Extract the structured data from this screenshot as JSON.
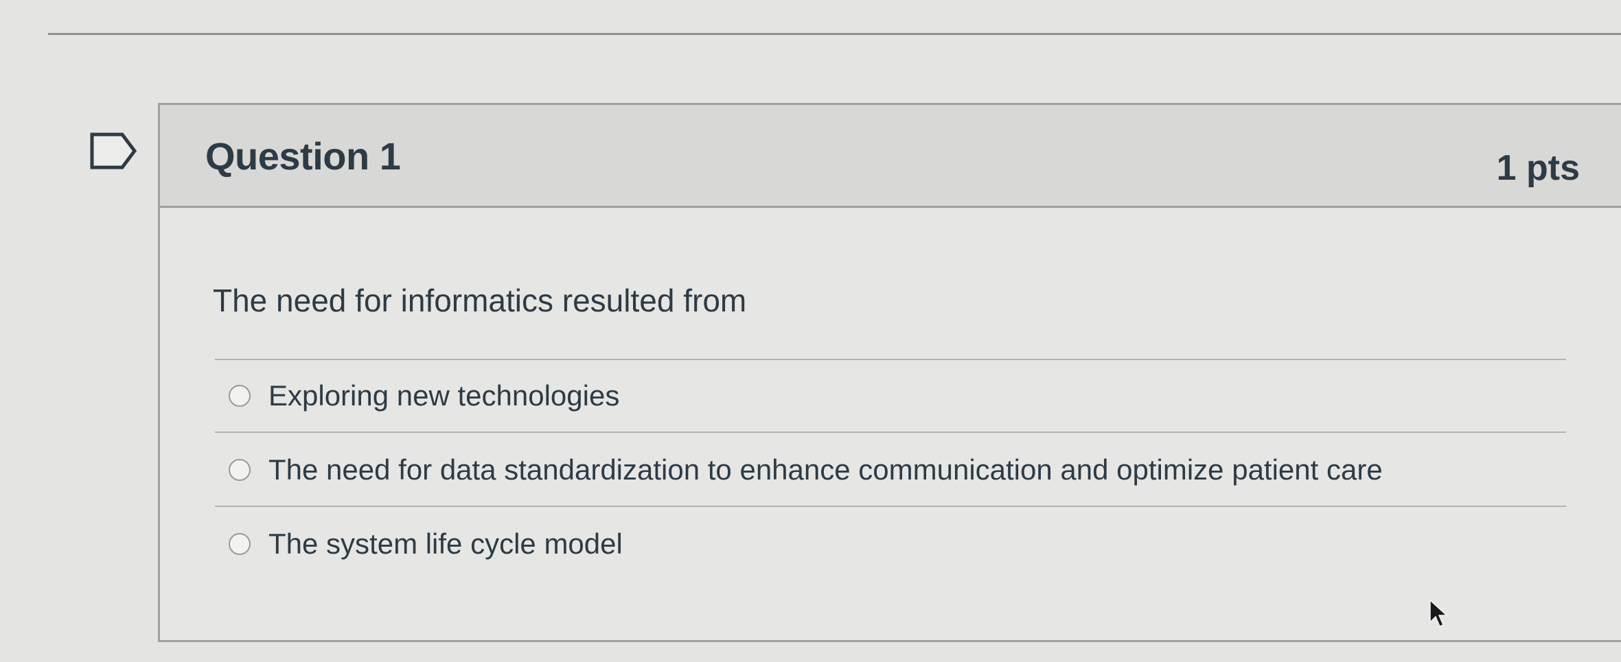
{
  "question": {
    "title": "Question 1",
    "points": "1 pts",
    "prompt": "The need for informatics resulted from",
    "flag_icon": "flag-outline-icon",
    "answers": [
      {
        "label": "Exploring new technologies",
        "selected": false
      },
      {
        "label": "The need for data standardization to enhance communication and optimize patient care",
        "selected": false
      },
      {
        "label": "The system life cycle model",
        "selected": false
      }
    ]
  },
  "colors": {
    "page_background": "#e4e4e2",
    "header_background": "#d8d8d6",
    "text": "#2d3b45",
    "border": "#a0a09e"
  }
}
